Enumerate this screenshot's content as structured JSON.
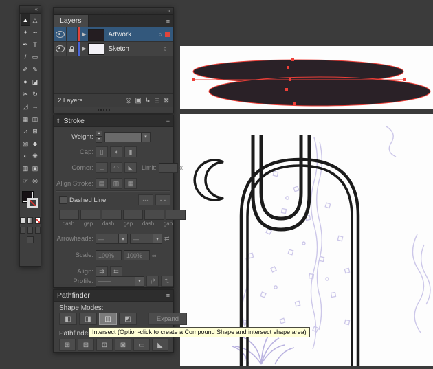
{
  "colors": {
    "accent_red": "#e0443c",
    "selection_blue": "#33587c",
    "tooltip_bg": "#ffffd6",
    "ink": "#1b1b1b",
    "sketch_lavender": "#ccc7e9",
    "artwork_fill": "#2a2127",
    "panel_bg": "#3f3f3f"
  },
  "icons": {
    "collapse": "«",
    "panel_menu": "≡",
    "dropdown": "▾",
    "step_up": "▴",
    "step_down": "▾",
    "expand_sections": "⇕",
    "triangle": "▶",
    "target": "○"
  },
  "toolbar": {
    "tools": [
      {
        "name": "selection",
        "glyph": "▲"
      },
      {
        "name": "direct-selection",
        "glyph": "△"
      },
      {
        "name": "magic-wand",
        "glyph": "✦"
      },
      {
        "name": "lasso",
        "glyph": "∽"
      },
      {
        "name": "pen",
        "glyph": "✒"
      },
      {
        "name": "type",
        "glyph": "T"
      },
      {
        "name": "line-segment",
        "glyph": "/"
      },
      {
        "name": "rectangle",
        "glyph": "▭"
      },
      {
        "name": "paintbrush",
        "glyph": "✐"
      },
      {
        "name": "pencil",
        "glyph": "✎"
      },
      {
        "name": "blob-brush",
        "glyph": "●"
      },
      {
        "name": "eraser",
        "glyph": "◪"
      },
      {
        "name": "scissors",
        "glyph": "✂"
      },
      {
        "name": "rotate",
        "glyph": "↻"
      },
      {
        "name": "scale",
        "glyph": "◿"
      },
      {
        "name": "width",
        "glyph": "↔"
      },
      {
        "name": "free-transform",
        "glyph": "▦"
      },
      {
        "name": "shape-builder",
        "glyph": "◫"
      },
      {
        "name": "perspective-grid",
        "glyph": "⊿"
      },
      {
        "name": "mesh",
        "glyph": "⊞"
      },
      {
        "name": "gradient",
        "glyph": "▨"
      },
      {
        "name": "eyedropper",
        "glyph": "◆"
      },
      {
        "name": "blend",
        "glyph": "◐"
      },
      {
        "name": "symbol-sprayer",
        "glyph": "❋"
      },
      {
        "name": "column-graph",
        "glyph": "▥"
      },
      {
        "name": "artboard",
        "glyph": "▣"
      },
      {
        "name": "hand",
        "glyph": "☞"
      },
      {
        "name": "zoom",
        "glyph": "◎"
      }
    ]
  },
  "layers_panel": {
    "title": "Layers",
    "rows": [
      {
        "name": "Artwork"
      },
      {
        "name": "Sketch"
      }
    ],
    "status": "2 Layers",
    "footer_icons": [
      {
        "name": "locate-object-icon",
        "glyph": "◎"
      },
      {
        "name": "clipping-mask-icon",
        "glyph": "▣"
      },
      {
        "name": "new-sublayer-icon",
        "glyph": "↳"
      },
      {
        "name": "new-layer-icon",
        "glyph": "⊞"
      },
      {
        "name": "delete-layer-icon",
        "glyph": "⊠"
      }
    ]
  },
  "stroke_panel": {
    "title": "Stroke",
    "weight_label": "Weight:",
    "cap_label": "Cap:",
    "corner_label": "Corner:",
    "limit_label": "Limit:",
    "limit_suffix": "x",
    "align_stroke_label": "Align Stroke:",
    "dashed_line_label": "Dashed Line",
    "dash_labels": [
      "dash",
      "gap",
      "dash",
      "gap",
      "dash",
      "gap"
    ],
    "arrowheads_label": "Arrowheads:",
    "scale_label": "Scale:",
    "scale_values": [
      "100%",
      "100%"
    ],
    "align_label": "Align:",
    "profile_label": "Profile:",
    "cap_icons": [
      "▯",
      "◖",
      "▮"
    ],
    "corner_icons": [
      "∟",
      "◠",
      "◣"
    ],
    "align_stroke_icons": [
      "▤",
      "▥",
      "▦"
    ],
    "dashed_btn_icons": [
      "---",
      "- -"
    ],
    "arrow_preview": "—",
    "swap_icon": "⇄",
    "link_icon": "∞",
    "align_icons": [
      "⇉",
      "⇇"
    ],
    "profile_preview": "——",
    "profile_flip_icons": [
      "⇄",
      "⇅"
    ]
  },
  "pathfinder_panel": {
    "title": "Pathfinder",
    "shape_modes_label": "Shape Modes:",
    "expand_label": "Expand",
    "pathfinders_label": "Pathfinders:",
    "shape_modes": [
      {
        "name": "unite",
        "glyph": "◧"
      },
      {
        "name": "minus-front",
        "glyph": "◨"
      },
      {
        "name": "intersect",
        "glyph": "◫"
      },
      {
        "name": "exclude",
        "glyph": "◩"
      }
    ],
    "pathfinders": [
      {
        "name": "divide",
        "glyph": "⊞"
      },
      {
        "name": "trim",
        "glyph": "⊟"
      },
      {
        "name": "merge",
        "glyph": "⊡"
      },
      {
        "name": "crop",
        "glyph": "⊠"
      },
      {
        "name": "outline",
        "glyph": "▭"
      },
      {
        "name": "minus-back",
        "glyph": "◣"
      }
    ]
  },
  "tooltip": {
    "text": "Intersect (Option-click to create a Compound Shape and intersect shape area)"
  }
}
